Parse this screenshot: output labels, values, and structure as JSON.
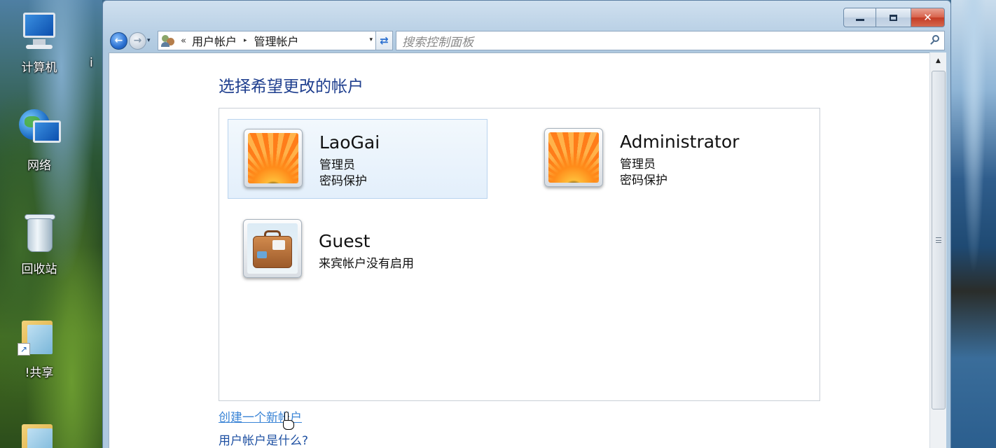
{
  "desktop": {
    "icons": [
      {
        "label": "计算机"
      },
      {
        "label": "网络"
      },
      {
        "label": "回收站"
      },
      {
        "label": "!共享"
      }
    ],
    "partial_label": "i"
  },
  "window": {
    "caption": {
      "minimize": "minimize",
      "maximize": "maximize",
      "close": "✕"
    },
    "nav": {
      "back_glyph": "←",
      "forward_glyph": "→",
      "recent_glyph": "▾"
    },
    "address": {
      "overflow": "«",
      "crumbs": [
        "用户帐户",
        "管理帐户"
      ],
      "separator": "▸",
      "dropdown": "▾"
    },
    "refresh_glyph": "⇄",
    "search": {
      "placeholder": "搜索控制面板"
    }
  },
  "main": {
    "title": "选择希望更改的帐户",
    "accounts": [
      {
        "name": "LaoGai",
        "role": "管理员",
        "status": "密码保护",
        "selected": true,
        "picture": "flower"
      },
      {
        "name": "Administrator",
        "role": "管理员",
        "status": "密码保护",
        "selected": false,
        "picture": "flower"
      },
      {
        "name": "Guest",
        "status": "来宾帐户没有启用",
        "selected": false,
        "picture": "suitcase"
      }
    ],
    "links": {
      "create": "创建一个新帐户",
      "what_is": "用户帐户是什么?"
    }
  },
  "scrollbar": {
    "up_glyph": "▲"
  },
  "colors": {
    "title_blue": "#1e3e8e",
    "link_blue": "#1e50a2",
    "link_hover": "#3a84d6",
    "selection_bg": "#e3effb",
    "close_red": "#c43c25"
  }
}
